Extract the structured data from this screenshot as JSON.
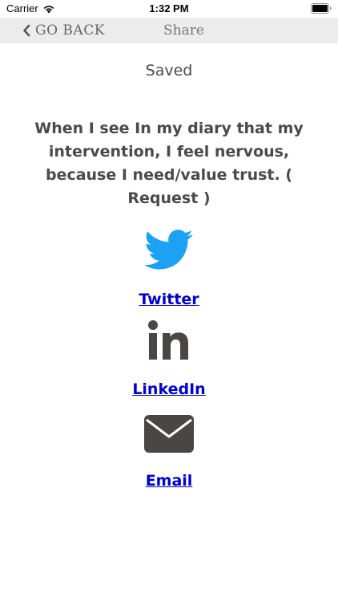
{
  "status_bar": {
    "carrier": "Carrier",
    "time": "1:32 PM"
  },
  "nav": {
    "back_label": "GO BACK",
    "title": "Share"
  },
  "content": {
    "saved_label": "Saved",
    "message": "When I see In my diary that my intervention, I feel nervous, because I need/value trust. ( Request )"
  },
  "share_options": [
    {
      "label": "Twitter",
      "icon": "twitter-icon"
    },
    {
      "label": "LinkedIn",
      "icon": "linkedin-icon"
    },
    {
      "label": "Email",
      "icon": "email-icon"
    }
  ],
  "colors": {
    "twitter": "#1da1f2",
    "icon_dark": "#4a4646",
    "link": "#0000cc",
    "nav_background": "#ececec",
    "text": "#4a4a4a"
  }
}
